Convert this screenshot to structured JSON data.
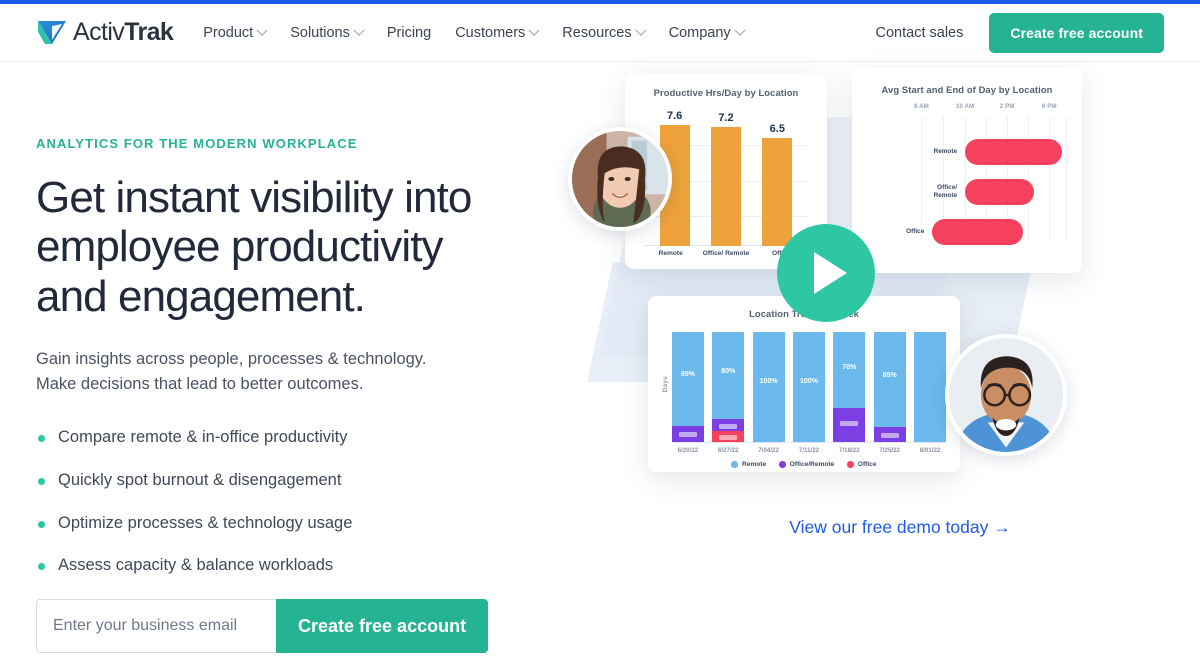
{
  "brand": {
    "name_light": "Activ",
    "name_bold": "Trak",
    "accent_teal": "#26b393",
    "accent_blue": "#1f5ae8"
  },
  "header": {
    "nav": [
      {
        "label": "Product",
        "has_chevron": true
      },
      {
        "label": "Solutions",
        "has_chevron": true
      },
      {
        "label": "Pricing",
        "has_chevron": false
      },
      {
        "label": "Customers",
        "has_chevron": true
      },
      {
        "label": "Resources",
        "has_chevron": true
      },
      {
        "label": "Company",
        "has_chevron": true
      }
    ],
    "contact_sales": "Contact sales",
    "cta": "Create free account"
  },
  "hero": {
    "eyebrow": "ANALYTICS FOR THE MODERN WORKPLACE",
    "headline": "Get instant visibility into employee productivity and engagement.",
    "subhead_line1": "Gain insights across people, processes & technology.",
    "subhead_line2": "Make decisions that lead to better outcomes.",
    "benefits": [
      "Compare remote & in-office productivity",
      "Quickly spot burnout & disengagement",
      "Optimize processes & technology usage",
      "Assess capacity & balance workloads"
    ],
    "form": {
      "email_placeholder": "Enter your business email",
      "email_value": "",
      "submit_label": "Create free account"
    },
    "demo_link": "View our free demo today →",
    "play_button_label": "play-video"
  },
  "chart_data": [
    {
      "type": "bar",
      "title": "Productive Hrs/Day by Location",
      "categories": [
        "Remote",
        "Office/\nRemote",
        "Office"
      ],
      "category_labels": [
        "Remote",
        "Office/ Remote",
        "Office"
      ],
      "values": [
        7.6,
        7.2,
        6.5
      ],
      "value_labels": [
        "7.6",
        "7.2",
        "6.5"
      ],
      "xlabel": "",
      "ylabel": "",
      "ylim": [
        0,
        8.2
      ],
      "grid": true,
      "bar_color": "#eda23c",
      "legend": "none"
    },
    {
      "type": "bar",
      "orientation": "horizontal-range",
      "title": "Avg Start and End of Day by Location",
      "categories": [
        "Remote",
        "Office/\nRemote",
        "Office"
      ],
      "category_labels": [
        "Remote",
        "Office/ Remote",
        "Office"
      ],
      "tick_labels": [
        "6 AM",
        "10 AM",
        "2 PM",
        "6 PM"
      ],
      "ranges": [
        {
          "category": "Remote",
          "start": "10 AM",
          "end": "6:30 PM"
        },
        {
          "category": "Office/Remote",
          "start": "10 AM",
          "end": "4 PM"
        },
        {
          "category": "Office",
          "start": "8 AM",
          "end": "4:30 PM"
        }
      ],
      "xlabel": "",
      "ylabel": "",
      "grid": true,
      "bar_color": "#f5405e",
      "legend": "none"
    },
    {
      "type": "bar",
      "stacked": true,
      "title": "Location Trend by Week",
      "title_visible": "Location ... Week",
      "categories": [
        "6/20/22",
        "6/27/22",
        "7/04/22",
        "7/11/22",
        "7/18/22",
        "7/25/22",
        "8/01/22"
      ],
      "ylabel": "Days",
      "series": [
        {
          "name": "Remote",
          "color": "#6bb9ed",
          "values": [
            85,
            80,
            100,
            100,
            70,
            85,
            100
          ],
          "labels": [
            "85%",
            "80%",
            "100%",
            "100%",
            "70%",
            "85%",
            ""
          ]
        },
        {
          "name": "Office/Remote",
          "color": "#7b3fe4",
          "values": [
            15,
            12,
            0,
            0,
            30,
            15,
            0
          ],
          "labels": [
            "",
            "",
            "",
            "",
            "",
            "",
            ""
          ]
        },
        {
          "name": "Office",
          "color": "#f5405e",
          "values": [
            0,
            8,
            0,
            0,
            0,
            0,
            0
          ],
          "labels": [
            "",
            "",
            "",
            "",
            "",
            "",
            ""
          ]
        }
      ],
      "legend": [
        "Remote",
        "Office/Remote",
        "Office"
      ],
      "legend_position": "bottom",
      "grid": false
    }
  ]
}
